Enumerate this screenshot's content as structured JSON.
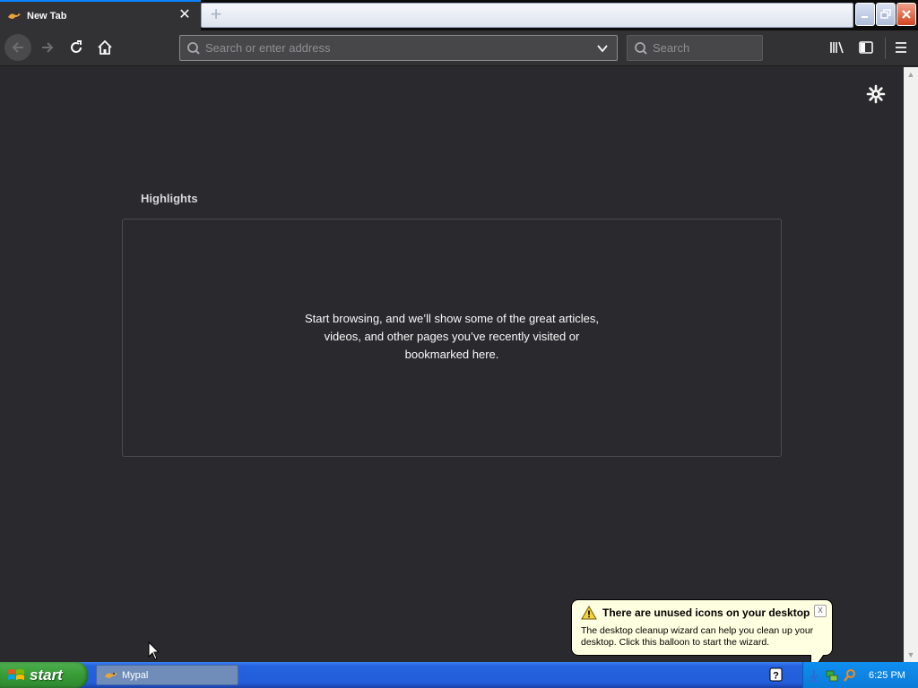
{
  "tab": {
    "title": "New Tab",
    "close": "✕",
    "new_tab": "+"
  },
  "window": {
    "minimize_icon": "minimize-icon",
    "maximize_icon": "restore-icon",
    "close_icon": "close-icon"
  },
  "navbar": {
    "address_placeholder": "Search or enter address",
    "search_placeholder": "Search"
  },
  "content": {
    "highlights_title": "Highlights",
    "highlights_message": "Start browsing, and we’ll show some of the great articles, videos, and other pages you’ve recently visited or bookmarked here."
  },
  "balloon": {
    "title": "There are unused icons on your desktop",
    "text": "The desktop cleanup wizard can help you clean up your desktop. Click this balloon to start the wizard.",
    "close": "x"
  },
  "taskbar": {
    "start_label": "start",
    "tasks": [
      {
        "label": "Mypal"
      }
    ],
    "clock": "6:25 PM"
  },
  "colors": {
    "content_bg": "#2a2a2e",
    "toolbar_bg": "#323234",
    "tab_accent": "#0a84ff",
    "balloon_bg": "#ffffe1",
    "taskbar_blue": "#245edb",
    "start_green": "#379c37"
  }
}
